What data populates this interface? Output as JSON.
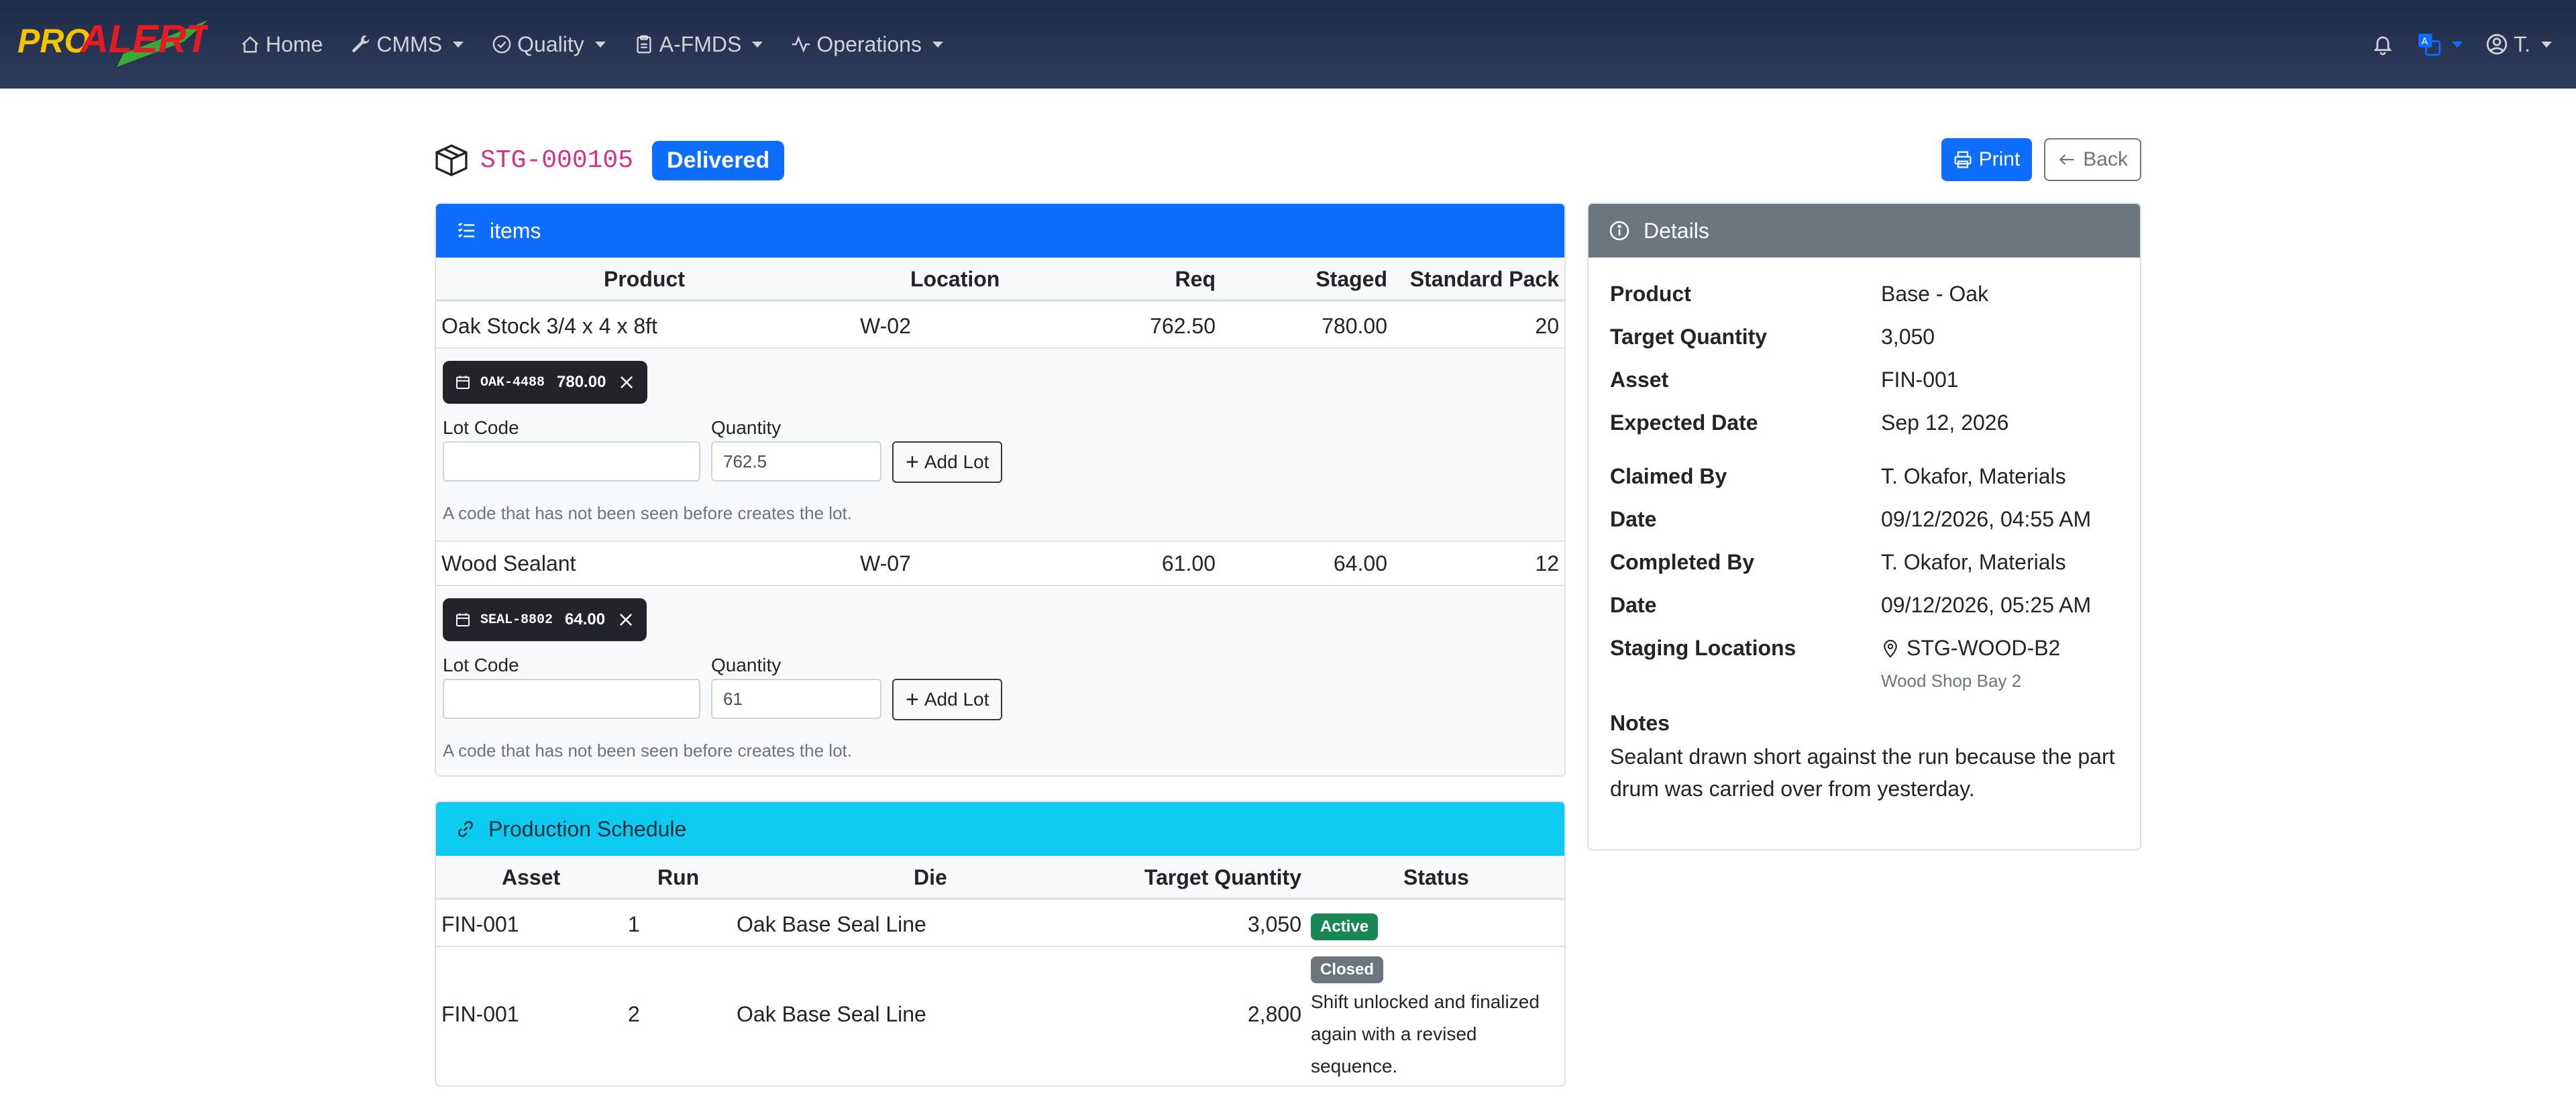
{
  "navbar": {
    "logo_text_pro": "PRO",
    "logo_text_alert": "ALERT",
    "items": [
      {
        "label": "Home",
        "icon": "home-icon",
        "caret": false
      },
      {
        "label": "CMMS",
        "icon": "wrench-icon",
        "caret": true
      },
      {
        "label": "Quality",
        "icon": "check-circle-icon",
        "caret": true
      },
      {
        "label": "A-FMDS",
        "icon": "clipboard-icon",
        "caret": true
      },
      {
        "label": "Operations",
        "icon": "activity-icon",
        "caret": true
      }
    ],
    "user_label": "T."
  },
  "header": {
    "code": "STG-000105",
    "status": "Delivered",
    "print_label": "Print",
    "back_label": "Back"
  },
  "items_card": {
    "title": "items",
    "columns": [
      "Product",
      "Location",
      "Req",
      "Staged",
      "Standard Pack"
    ],
    "rows": [
      {
        "product": "Oak Stock 3/4 x 4 x 8ft",
        "location": "W-02",
        "req": "762.50",
        "staged": "780.00",
        "pack": "20",
        "lot": {
          "code": "OAK-4488",
          "qty": "780.00"
        },
        "lot_code_label": "Lot Code",
        "quantity_label": "Quantity",
        "quantity_value": "762.5",
        "add_lot_label": "Add Lot",
        "help": "A code that has not been seen before creates the lot."
      },
      {
        "product": "Wood Sealant",
        "location": "W-07",
        "req": "61.00",
        "staged": "64.00",
        "pack": "12",
        "lot": {
          "code": "SEAL-8802",
          "qty": "64.00"
        },
        "lot_code_label": "Lot Code",
        "quantity_label": "Quantity",
        "quantity_value": "61",
        "add_lot_label": "Add Lot",
        "help": "A code that has not been seen before creates the lot."
      }
    ]
  },
  "schedule_card": {
    "title": "Production Schedule",
    "columns": [
      "Asset",
      "Run",
      "Die",
      "Target Quantity",
      "Status"
    ],
    "rows": [
      {
        "asset": "FIN-001",
        "run": "1",
        "die": "Oak Base Seal Line",
        "target": "3,050",
        "status": "Active",
        "status_color": "#198754",
        "note": ""
      },
      {
        "asset": "FIN-001",
        "run": "2",
        "die": "Oak Base Seal Line",
        "target": "2,800",
        "status": "Closed",
        "status_color": "#6c757d",
        "note_lines": [
          "Shift unlocked and finalized",
          "again with a revised",
          "sequence."
        ]
      }
    ]
  },
  "details_card": {
    "title": "Details",
    "fields": [
      {
        "k": "Product",
        "v": "Base - Oak"
      },
      {
        "k": "Target Quantity",
        "v": "3,050"
      },
      {
        "k": "Asset",
        "v": "FIN-001"
      },
      {
        "k": "Expected Date",
        "v": "Sep 12, 2026"
      },
      {
        "k": "Claimed By",
        "v": "T. Okafor, Materials"
      },
      {
        "k": "Date",
        "v": "09/12/2026, 04:55 AM"
      },
      {
        "k": "Completed By",
        "v": "T. Okafor, Materials"
      },
      {
        "k": "Date",
        "v": "09/12/2026, 05:25 AM"
      },
      {
        "k": "Staging Locations",
        "v": "STG-WOOD-B2",
        "sub": "Wood Shop Bay 2"
      }
    ],
    "notes_label": "Notes",
    "notes_lines": [
      "Sealant drawn short against the run because the part",
      "drum was carried over from yesterday."
    ]
  },
  "colors": {
    "primary": "#0d6efd",
    "info": "#0dcaf0",
    "secondary": "#6c757d",
    "success": "#198754",
    "code_pink": "#d63384"
  }
}
